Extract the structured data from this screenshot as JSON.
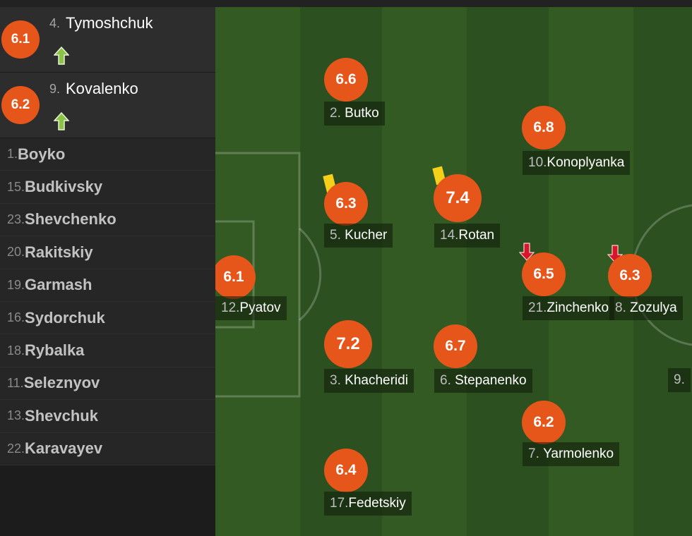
{
  "substitutes_in": [
    {
      "number": "4.",
      "name": "Tymoshchuk",
      "rating": "6.1",
      "icon": "sub-in-arrow-icon"
    },
    {
      "number": "9.",
      "name": "Kovalenko",
      "rating": "6.2",
      "icon": "sub-in-arrow-icon"
    }
  ],
  "bench": [
    {
      "number": "1.",
      "name": "Boyko"
    },
    {
      "number": "15.",
      "name": "Budkivsky"
    },
    {
      "number": "23.",
      "name": "Shevchenko"
    },
    {
      "number": "20.",
      "name": "Rakitskiy"
    },
    {
      "number": "19.",
      "name": "Garmash"
    },
    {
      "number": "16.",
      "name": "Sydorchuk"
    },
    {
      "number": "18.",
      "name": "Rybalka"
    },
    {
      "number": "11.",
      "name": "Seleznyov"
    },
    {
      "number": "13.",
      "name": "Shevchuk"
    },
    {
      "number": "22.",
      "name": "Karavayev"
    }
  ],
  "pitch_players": [
    {
      "id": "butko",
      "number": "2.",
      "name": "Butko",
      "rating": "6.6"
    },
    {
      "id": "konoplyanka",
      "number": "10.",
      "name": "Konoplyanka",
      "rating": "6.8"
    },
    {
      "id": "kucher",
      "number": "5.",
      "name": "Kucher",
      "rating": "6.3",
      "yellow_card": true
    },
    {
      "id": "rotan",
      "number": "14.",
      "name": "Rotan",
      "rating": "7.4",
      "yellow_card": true
    },
    {
      "id": "pyatov",
      "number": "12.",
      "name": "Pyatov",
      "rating": "6.1"
    },
    {
      "id": "zinchenko",
      "number": "21.",
      "name": "Zinchenko",
      "rating": "6.5",
      "subbed_off": true
    },
    {
      "id": "zozulya",
      "number": "8.",
      "name": "Zozulya",
      "rating": "6.3",
      "subbed_off": true
    },
    {
      "id": "khacheridi",
      "number": "3.",
      "name": "Khacheridi",
      "rating": "7.2"
    },
    {
      "id": "stepanenko",
      "number": "6.",
      "name": "Stepanenko",
      "rating": "6.7"
    },
    {
      "id": "yarmolenko",
      "number": "7.",
      "name": "Yarmolenko",
      "rating": "6.2"
    },
    {
      "id": "fedetskiy",
      "number": "17.",
      "name": "Fedetskiy",
      "rating": "6.4"
    },
    {
      "id": "partial",
      "number": "9.",
      "name": "",
      "rating": ""
    }
  ],
  "colors": {
    "rating": "#e6561b",
    "sub_in_arrow": "#8bc34a",
    "sub_off_arrow": "#d6162a",
    "yellow_card": "#f4d01a"
  }
}
